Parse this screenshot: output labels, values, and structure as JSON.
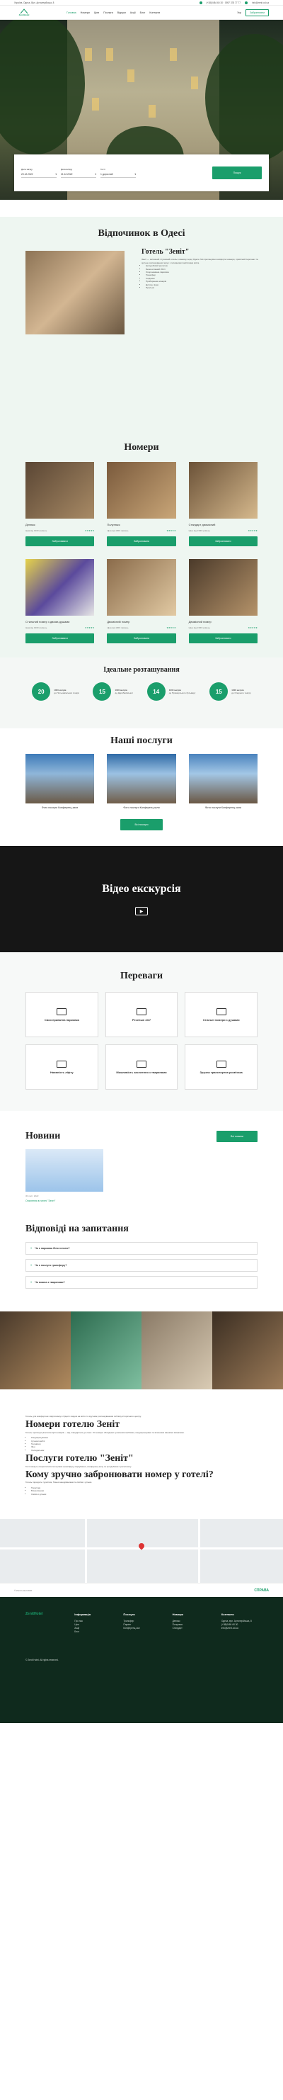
{
  "topbar": {
    "address": "Україна, Одеса, Вул. Артилерійська, 8",
    "phones": "(+38)0484 60 30 · 0957 378 77 77",
    "email": "info@zenit.od.ua"
  },
  "nav": {
    "logo": "ZenitHotel",
    "items": [
      "Головна",
      "Номери",
      "Ціни",
      "Послуги",
      "Відгуки",
      "Акції",
      "Блог",
      "Контакти"
    ],
    "lang": "Укр",
    "cta": "Забронювати"
  },
  "booking": {
    "checkin_label": "Дата заїзду",
    "checkin": "20.12.2022",
    "checkout_label": "Дата виїзду",
    "checkout": "21.12.2022",
    "guests_label": "Гості",
    "guests": "1 дорослий",
    "search": "Пошук"
  },
  "about": {
    "title": "Відпочинок в Одесі",
    "hotel_title": "Готель \"Зеніт\"",
    "text": "Зеніт — затишний і сучасний готель в самому серці Одеси. Ми пропонуємо комфортні номери, привітний персонал та зручне розташування поруч з головними пам'ятками міста.",
    "features": [
      "Цілодобовий ресепшн",
      "Безкоштовний Wi-Fi",
      "Охоронювана парковка",
      "Трансфер",
      "Сніданки",
      "Прибирання номерів",
      "Дитяче ліжко",
      "Пральня"
    ]
  },
  "rooms": {
    "title": "Номери",
    "book": "Забронювати",
    "items": [
      {
        "name": "Делюкс",
        "price": "Ціна від 1300 гривень"
      },
      {
        "name": "Полулюкс",
        "price": "Ціна від 1300 гривень"
      },
      {
        "name": "Стандарт двомісний",
        "price": "Ціна від 1300 гривень"
      },
      {
        "name": "Стильний номер з двома душами",
        "price": "Ціна від 1300 гривень"
      },
      {
        "name": "Двомісний номер",
        "price": "Ціна від 1300 гривень"
      },
      {
        "name": "Двомісний номер",
        "price": "Ціна від 1300 гривень"
      }
    ]
  },
  "stats": {
    "title": "Ідеальне розташування",
    "items": [
      {
        "n": "20",
        "dist": "1000 метрів",
        "lbl": "до Потьомкінських сходів"
      },
      {
        "n": "15",
        "dist": "1000 метрів",
        "lbl": "до Дерибасівської"
      },
      {
        "n": "14",
        "dist": "1000 метрів",
        "lbl": "до Приморського бульвару"
      },
      {
        "n": "15",
        "dist": "1000 метрів",
        "lbl": "до Оперного театру"
      }
    ]
  },
  "services": {
    "title": "Наші послуги",
    "items": [
      "Фото послуги Конференц-зали",
      "Фото послуги Конференц-зали",
      "Фото послуги Конференц-зали"
    ],
    "more": "Всі послуги"
  },
  "video": {
    "title": "Відео екскурсія"
  },
  "advantages": {
    "title": "Переваги",
    "items": [
      "Своя приватна парковка",
      "Ресепшн 24/7",
      "Стильні номери з душами",
      "Наявність ліфту",
      "Можливість заселення з тваринами",
      "Зручна транспортна розв'язка"
    ]
  },
  "news": {
    "title": "Новини",
    "all": "Всі новини",
    "date": "30 лист. 2022",
    "link": "Опалення в готелі \"Зеніт\""
  },
  "faq": {
    "title": "Відповіді на запитання",
    "items": [
      "Чи є парковка біля готелю?",
      "Чи є послуга трансферу?",
      "Чи можна з тваринами?"
    ]
  },
  "seo": {
    "intro": "Готель для комфортного відпочинку в Одесі з видом на місто та зручним розташуванням поблизу історичного центру.",
    "h1": "Номери готелю Зеніт",
    "p1": "Готель пропонує різні категорії номерів — від стандартних до люкс. Усі номери обладнані сучасними меблями, кондиціонерами та власними ванними кімнатами.",
    "list1": [
      "Кондиціонування",
      "Сучасні меблі",
      "Телевізор",
      "Фен",
      "Холодильник"
    ],
    "h2": "Послуги готелю \"Зеніт\"",
    "p2": "Гості можуть скористатися послугами трансферу, паркування, конференц-залу та цілодобового ресепшену.",
    "h3": "Кому зручно забронювати номер у готелі?",
    "p3": "Готель підходить туристам, бізнес-мандрівникам та сім'ям з дітьми.",
    "list2": [
      "Туристам",
      "Бізнесменам",
      "Сім'ям з дітьми"
    ]
  },
  "footer_bar": {
    "copy": "© Zenit Hotel 2022",
    "brand": "СПРАВА"
  },
  "footer": {
    "logo": "ZenitHotel",
    "cols": [
      {
        "h": "Інформація",
        "items": [
          "Про нас",
          "Ціни",
          "Акції",
          "Блог"
        ]
      },
      {
        "h": "Послуги",
        "items": [
          "Трансфер",
          "Паркінг",
          "Конференц-зал"
        ]
      },
      {
        "h": "Номери",
        "items": [
          "Делюкс",
          "Полулюкс",
          "Стандарт"
        ]
      },
      {
        "h": "Контакти",
        "items": [
          "Одеса, вул. Артилерійська, 8",
          "(+38)0484 60 30",
          "info@zenit.od.ua"
        ]
      }
    ],
    "bottom": "© Zenit Hotel. All rights reserved."
  }
}
